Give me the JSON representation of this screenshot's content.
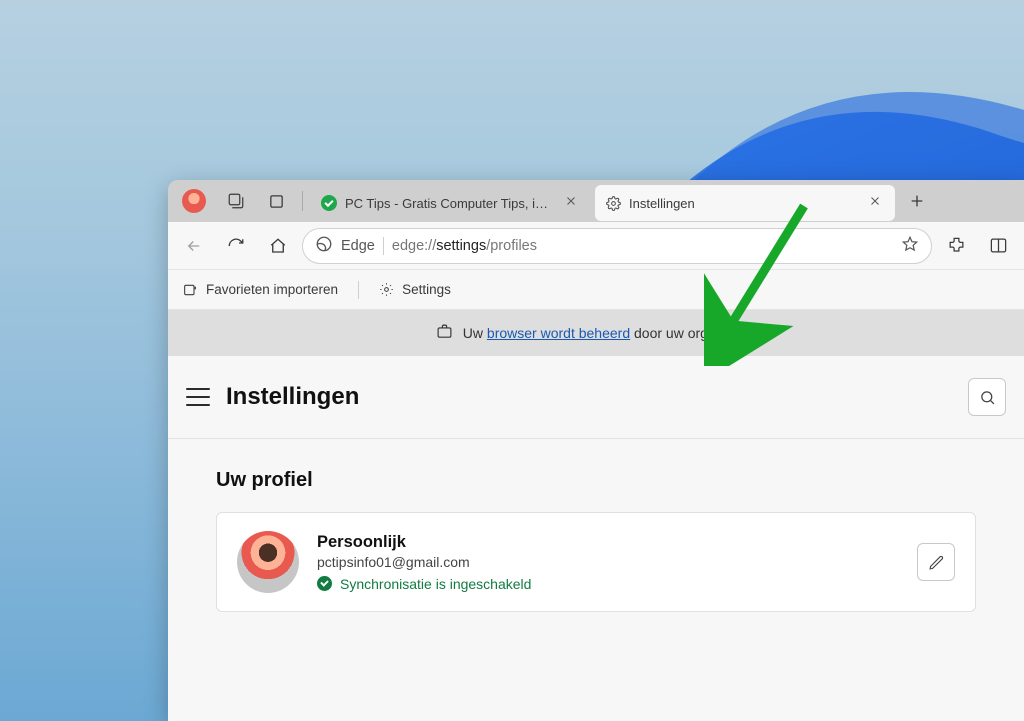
{
  "tabs": {
    "tab1_label": "PC Tips - Gratis Computer Tips, i…",
    "tab2_label": "Instellingen"
  },
  "toolbar": {
    "edge_label": "Edge",
    "url_prefix": "edge://",
    "url_bold": "settings",
    "url_suffix": "/profiles"
  },
  "bookmarks": {
    "import_label": "Favorieten importeren",
    "settings_label": "Settings"
  },
  "banner": {
    "prefix": "Uw ",
    "link": "browser wordt beheerd",
    "suffix": " door uw organisatie"
  },
  "settings": {
    "title": "Instellingen",
    "profile_heading": "Uw profiel",
    "profile_name": "Persoonlijk",
    "profile_email": "pctipsinfo01@gmail.com",
    "sync_label": "Synchronisatie is ingeschakeld"
  }
}
